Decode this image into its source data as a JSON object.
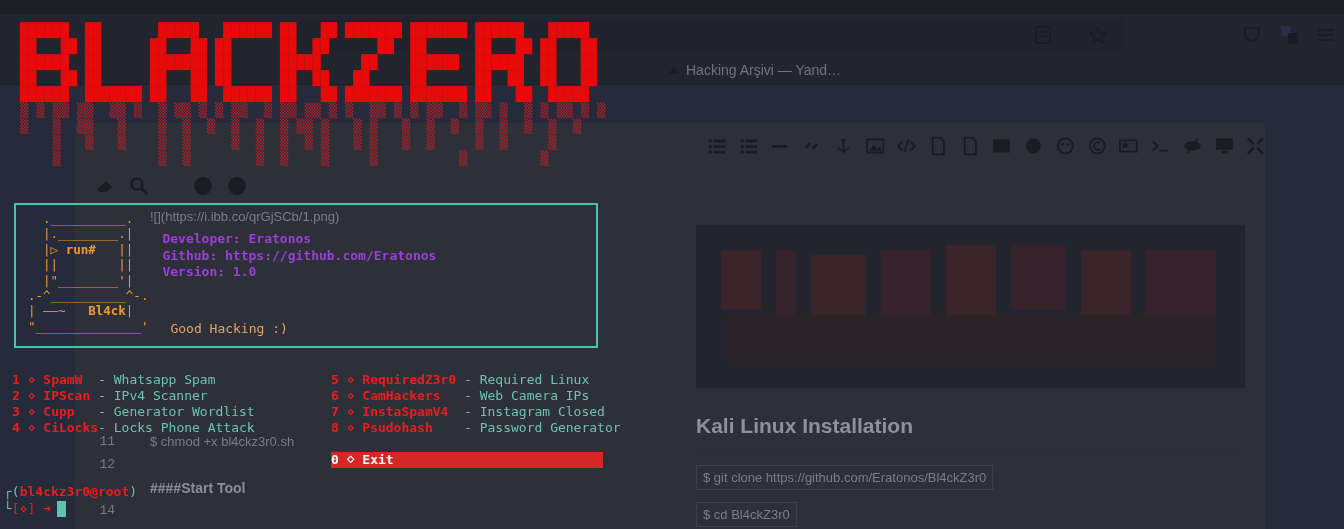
{
  "browser": {
    "bookmark": "Hacking Arşivi — Yand…"
  },
  "editor": {
    "first_text": "![](https://i.ibb.co/qrGjSCb/1.png)",
    "lines": [
      {
        "number": "11",
        "text": "$ chmod +x bl4ckz3r0.sh"
      },
      {
        "number": "12"
      },
      {
        "text": "####Start Tool"
      },
      {
        "number": "14"
      }
    ]
  },
  "preview": {
    "heading": "Kali Linux Installation",
    "code": [
      "$ git clone https://github.com/Eratonos/Bl4ckZ3r0",
      "$ cd Bl4ckZ3r0"
    ]
  },
  "terminal": {
    "banner": {
      "solid": [
        "██████  ██       █████   ██████ ██   ██ ███████ ███████ ██████   █████ ",
        "██   ██ ██      ██   ██ ██      ██  ██      ██  ██      ██   ██ ██   ██",
        "██████  ██      ███████ ██      █████     ██    ██████  ██████  ██   ██",
        "██   ██ ██      ██   ██ ██      ██  ██   ██     ██      ██  ██  ██   ██",
        "██████  ███████ ██   ██  ██████ ██   ██ ███████ ███████ ██   ██  █████ "
      ],
      "drips": [
        "▒ ▒ ▒▒ ▒▒  ▒▒ ▒  ▒ ▒▒ ▒ ▒ ▒▒  ▒ ▒▒ ▒▒ ▒ ▒  ▒▒ ▒ ▒ ▒▒  ▒ ▒▒ ▒  ▒ ▒ ▒▒ ▒ ▒",
        "▒   ▒  ▒▒   ▒    ▒  ▒  ▒  ▒  ▒  ▒ ▒▒ ▒   ▒ ▒   ▒  ▒  ▒  ▒  ▒  ▒  ▒  ▒",
        "    ▒   ▒   ▒    ▒  ▒     ▒  ▒  ▒  ▒ ▒   ▒ ▒   ▒  ▒     ▒  ▒     ▒   ",
        "    ▒            ▒  ▒        ▒  ▒    ▒     ▒          ▒         ▒    "
      ]
    },
    "logo_art": [
      "  .__________.",
      "  |.________.|",
      "  |▷ **run#**   ||",
      "  ||        ||",
      "  |\"________'|",
      ".-^__________^-.",
      "| ——~   **Bl4ck**|",
      "\"______________'"
    ],
    "info": [
      "Developer: Eratonos",
      "Github: https://github.com/Eratonos",
      "Version: 1.0"
    ],
    "greeting": "Good Hacking :)",
    "menu": [
      [
        {
          "kind": "tool",
          "number": "1",
          "bullet": "⋄",
          "name": "SpamW",
          "description": "- Whatsapp Spam"
        },
        {
          "kind": "tool",
          "number": "2",
          "bullet": "⋄",
          "name": "IPScan",
          "description": "- IPv4 Scanner"
        },
        {
          "kind": "tool",
          "number": "3",
          "bullet": "⋄",
          "name": "Cupp",
          "description": "- Generator Wordlist"
        },
        {
          "kind": "tool",
          "number": "4",
          "bullet": "⋄",
          "name": "CiLocks",
          "description": "- Locks Phone Attack"
        }
      ],
      [
        {
          "kind": "tool",
          "number": "5",
          "bullet": "⋄",
          "name": "RequiredZ3r0",
          "description": "- Required Linux"
        },
        {
          "kind": "tool",
          "number": "6",
          "bullet": "⋄",
          "name": "CamHackers",
          "description": "- Web Camera IPs"
        },
        {
          "kind": "tool",
          "number": "7",
          "bullet": "⋄",
          "name": "InstaSpamV4",
          "description": "- Instagram Closed"
        },
        {
          "kind": "tool",
          "number": "8",
          "bullet": "⋄",
          "name": "Psudohash",
          "description": "- Password Generator"
        },
        {
          "kind": "exit",
          "number": "0",
          "bullet": "⋄",
          "name": "Exit"
        }
      ]
    ],
    "prompt": {
      "open": "┌(",
      "user": "bl4ckz3r0@root",
      "close": ")",
      "corner": "└",
      "symbol": "[⋄]",
      "arrow": "➜"
    }
  }
}
